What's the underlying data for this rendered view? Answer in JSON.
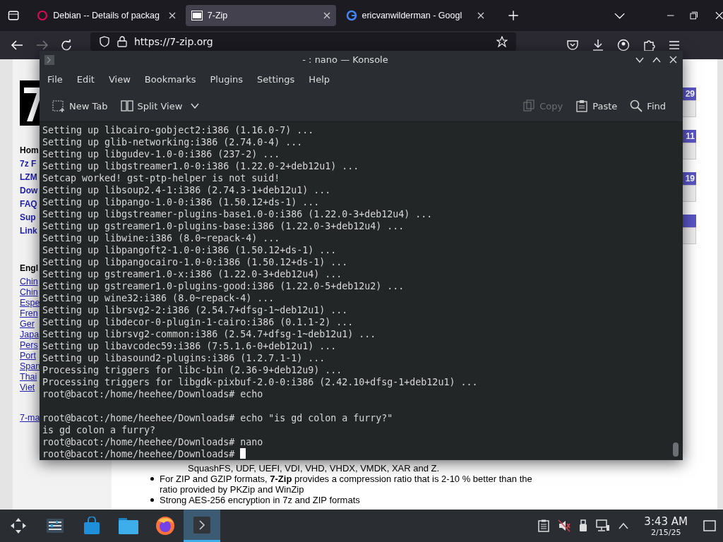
{
  "browser": {
    "tabs": [
      {
        "title": "Debian -- Details of packag",
        "selected": false
      },
      {
        "title": "7-Zip",
        "selected": true
      },
      {
        "title": "ericvanwilderman - Googl",
        "selected": false
      }
    ],
    "url": "https://7-zip.org"
  },
  "website": {
    "sidebar": [
      {
        "text": "Hom",
        "kind": "heading"
      },
      {
        "text": "7z F",
        "kind": "nav"
      },
      {
        "text": "LZM",
        "kind": "nav"
      },
      {
        "text": "Dow",
        "kind": "nav"
      },
      {
        "text": "FAQ",
        "kind": "nav"
      },
      {
        "text": "Sup",
        "kind": "nav"
      },
      {
        "text": "Link",
        "kind": "nav"
      },
      {
        "text": "Engl",
        "kind": "heading"
      },
      {
        "text": "Chin",
        "kind": "lang"
      },
      {
        "text": "Chin",
        "kind": "lang"
      },
      {
        "text": "Espe",
        "kind": "lang"
      },
      {
        "text": "Fren",
        "kind": "lang"
      },
      {
        "text": "Ger",
        "kind": "lang"
      },
      {
        "text": "Japa",
        "kind": "lang"
      },
      {
        "text": "Pers",
        "kind": "lang"
      },
      {
        "text": "Port",
        "kind": "lang"
      },
      {
        "text": "Span",
        "kind": "lang"
      },
      {
        "text": "Thai",
        "kind": "lang"
      },
      {
        "text": "Viet",
        "kind": "lang"
      },
      {
        "text": "7-ma",
        "kind": "footer"
      }
    ],
    "news": [
      {
        "kind": "dated",
        "date": "29"
      },
      {
        "kind": "dated",
        "date": "11"
      },
      {
        "kind": "dated",
        "date": "19"
      },
      {
        "kind": "undated"
      }
    ],
    "features": [
      {
        "text": "SquashFS, UDF, UEFI, VDI, VHD, VHDX, VMDK, XAR and Z.",
        "kind": "continuation"
      },
      {
        "text": "For ZIP and GZIP formats, **7-Zip** provides a compression ratio that is 2-10 % better than the ratio provided by PKZip and WinZip",
        "kind": "bullet"
      },
      {
        "text": "Strong AES-256 encryption in 7z and ZIP formats",
        "kind": "bullet"
      }
    ]
  },
  "konsole": {
    "title": "- : nano — Konsole",
    "menu": [
      "File",
      "Edit",
      "View",
      "Bookmarks",
      "Plugins",
      "Settings",
      "Help"
    ],
    "toolbar": [
      {
        "label": "New Tab",
        "disabled": false
      },
      {
        "label": "Split View",
        "disabled": false
      },
      {
        "label": "Copy",
        "disabled": true
      },
      {
        "label": "Paste",
        "disabled": false
      },
      {
        "label": "Find",
        "disabled": false
      }
    ],
    "lines": [
      {
        "kind": "output",
        "text": "Setting up libcairo-gobject2:i386 (1.16.0-7) ..."
      },
      {
        "kind": "output",
        "text": "Setting up glib-networking:i386 (2.74.0-4) ..."
      },
      {
        "kind": "output",
        "text": "Setting up libgudev-1.0-0:i386 (237-2) ..."
      },
      {
        "kind": "output",
        "text": "Setting up libgstreamer1.0-0:i386 (1.22.0-2+deb12u1) ..."
      },
      {
        "kind": "output",
        "text": "Setcap worked! gst-ptp-helper is not suid!"
      },
      {
        "kind": "output",
        "text": "Setting up libsoup2.4-1:i386 (2.74.3-1+deb12u1) ..."
      },
      {
        "kind": "output",
        "text": "Setting up libpango-1.0-0:i386 (1.50.12+ds-1) ..."
      },
      {
        "kind": "output",
        "text": "Setting up libgstreamer-plugins-base1.0-0:i386 (1.22.0-3+deb12u4) ..."
      },
      {
        "kind": "output",
        "text": "Setting up gstreamer1.0-plugins-base:i386 (1.22.0-3+deb12u4) ..."
      },
      {
        "kind": "output",
        "text": "Setting up libwine:i386 (8.0~repack-4) ..."
      },
      {
        "kind": "output",
        "text": "Setting up libpangoft2-1.0-0:i386 (1.50.12+ds-1) ..."
      },
      {
        "kind": "output",
        "text": "Setting up libpangocairo-1.0-0:i386 (1.50.12+ds-1) ..."
      },
      {
        "kind": "output",
        "text": "Setting up gstreamer1.0-x:i386 (1.22.0-3+deb12u4) ..."
      },
      {
        "kind": "output",
        "text": "Setting up gstreamer1.0-plugins-good:i386 (1.22.0-5+deb12u2) ..."
      },
      {
        "kind": "output",
        "text": "Setting up wine32:i386 (8.0~repack-4) ..."
      },
      {
        "kind": "output",
        "text": "Setting up librsvg2-2:i386 (2.54.7+dfsg-1~deb12u1) ..."
      },
      {
        "kind": "output",
        "text": "Setting up libdecor-0-plugin-1-cairo:i386 (0.1.1-2) ..."
      },
      {
        "kind": "output",
        "text": "Setting up librsvg2-common:i386 (2.54.7+dfsg-1~deb12u1) ..."
      },
      {
        "kind": "output",
        "text": "Setting up libavcodec59:i386 (7:5.1.6-0+deb12u1) ..."
      },
      {
        "kind": "output",
        "text": "Setting up libasound2-plugins:i386 (1.2.7.1-1) ..."
      },
      {
        "kind": "output",
        "text": "Processing triggers for libc-bin (2.36-9+deb12u9) ..."
      },
      {
        "kind": "output",
        "text": "Processing triggers for libgdk-pixbuf-2.0-0:i386 (2.42.10+dfsg-1+deb12u1) ..."
      },
      {
        "kind": "output",
        "text": "root@bacot:/home/heehee/Downloads# echo"
      },
      {
        "kind": "blank"
      },
      {
        "kind": "output",
        "text": "root@bacot:/home/heehee/Downloads# echo \"is gd colon a furry?\""
      },
      {
        "kind": "output",
        "text": "is gd colon a furry?"
      },
      {
        "kind": "output",
        "text": "root@bacot:/home/heehee/Downloads# nano"
      },
      {
        "kind": "prompt",
        "text": "root@bacot:/home/heehee/Downloads#"
      }
    ]
  },
  "taskbar": {
    "apps": [
      {
        "active": false
      },
      {
        "active": false
      },
      {
        "active": false
      },
      {
        "active": false
      },
      {
        "active": false
      },
      {
        "active": true
      }
    ],
    "time": "3:43 AM",
    "date": "2/15/25"
  }
}
